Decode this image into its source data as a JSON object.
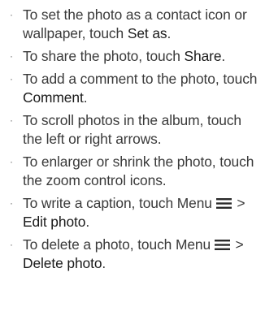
{
  "bullet_symbol": "·",
  "items": [
    {
      "text": "To set the photo as a contact icon or wallpaper, touch ",
      "keyword": "Set as",
      "suffix": "."
    },
    {
      "text": "To share the photo, touch ",
      "keyword": "Share",
      "suffix": "."
    },
    {
      "text": "To add a comment to the photo, touch ",
      "keyword": "Comment",
      "suffix": "."
    },
    {
      "text": "To scroll photos in the album, touch the left or right arrows."
    },
    {
      "text": "To enlarger or shrink the photo, touch the zoom control icons."
    },
    {
      "text": "To write a caption, touch Menu ",
      "icon": "menu-icon",
      "separator": " > ",
      "keyword": "Edit photo",
      "suffix": "."
    },
    {
      "text": "To delete a photo, touch Menu ",
      "icon": "menu-icon",
      "separator": " > ",
      "keyword": "Delete photo",
      "suffix": "."
    }
  ]
}
